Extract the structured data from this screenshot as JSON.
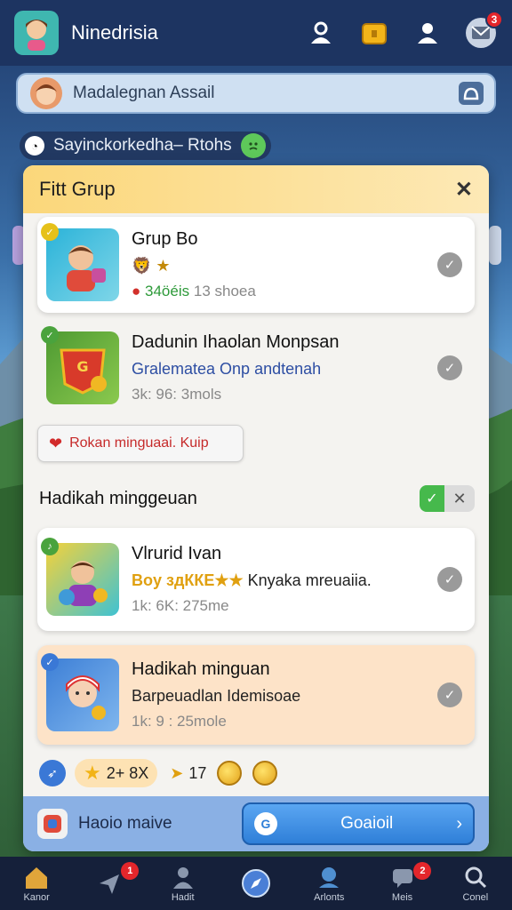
{
  "app": {
    "title": "Ninedrisia"
  },
  "header": {
    "notification_count": "3"
  },
  "search": {
    "text": "Madalegnan Assail"
  },
  "chip": {
    "text": "Sayinckorkedha– Rtohs"
  },
  "panel": {
    "title": "Fitt Grup",
    "cards": [
      {
        "title": "Grup Bo",
        "sub": "🦁 ★",
        "meta": "● 34öéis 13 ѕhoea",
        "meta_green": "34öéis",
        "meta_tail": "13 ѕhoea"
      },
      {
        "title": "Dadunin Ihaolan Monpsan",
        "sub": "Gralematea Onp andtenah",
        "meta": "3k: 96: 3mols"
      },
      {
        "title": "Vlrurid Ivan",
        "sub_gold": "Boy здККЕ★★",
        "sub_tail": "Knyaka mreuaiia.",
        "meta": "1k: 6K: 275me"
      },
      {
        "title": "Hadikah minguan",
        "sub": "Barpeuadlan Idemisoae",
        "meta": "1k: 9 : 25mole"
      }
    ],
    "reject_button": "Rokan minguaai. Kuip",
    "section_title": "Hadikah minggeuan",
    "rewards": {
      "pill": "2+ 8X",
      "flag_count": "17"
    },
    "bottom_label": "Haoio maive",
    "primary_button": "Goaioil"
  },
  "nav": {
    "items": [
      {
        "label": "Kanor",
        "badge": ""
      },
      {
        "label": "",
        "badge": "1"
      },
      {
        "label": "Hadit",
        "badge": ""
      },
      {
        "label": "",
        "badge": ""
      },
      {
        "label": "Arlonts",
        "badge": ""
      },
      {
        "label": "Meis",
        "badge": "2"
      },
      {
        "label": "Conel",
        "badge": ""
      }
    ]
  },
  "colors": {
    "accent": "#2f7fd8",
    "header_bg": "#1d3461",
    "panel_head": "#fbd77a",
    "badge": "#e3262b"
  },
  "icons": [
    "user-icon",
    "treasure-box-icon",
    "user-plus-icon",
    "mail-icon",
    "search-icon",
    "home-icon",
    "map-pin-icon",
    "profile-icon",
    "compass-icon",
    "coins-icon",
    "settings-icon"
  ]
}
